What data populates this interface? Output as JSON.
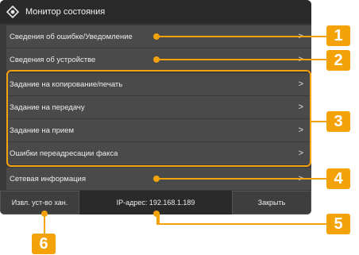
{
  "title": "Монитор состояния",
  "items": [
    {
      "label": "Сведения об ошибке/Уведомление",
      "chevron": ">"
    },
    {
      "label": "Сведения об устройстве",
      "chevron": ">"
    },
    {
      "label": "Задание на копирование/печать",
      "chevron": ">"
    },
    {
      "label": "Задание на передачу",
      "chevron": ">"
    },
    {
      "label": "Задание на прием",
      "chevron": ">"
    },
    {
      "label": "Ошибки переадресации факса",
      "chevron": ">"
    },
    {
      "label": "Сетевая информация",
      "chevron": ">"
    }
  ],
  "bottom": {
    "left_button": "Извл. уст-во хан.",
    "ip_text": "IP-адрес: 192.168.1.189",
    "close_button": "Закрыть"
  },
  "callouts": [
    "1",
    "2",
    "3",
    "4",
    "5",
    "6"
  ],
  "colors": {
    "accent": "#f4a20a",
    "panel": "#3a3a3a",
    "row": "#4a4a4a"
  }
}
